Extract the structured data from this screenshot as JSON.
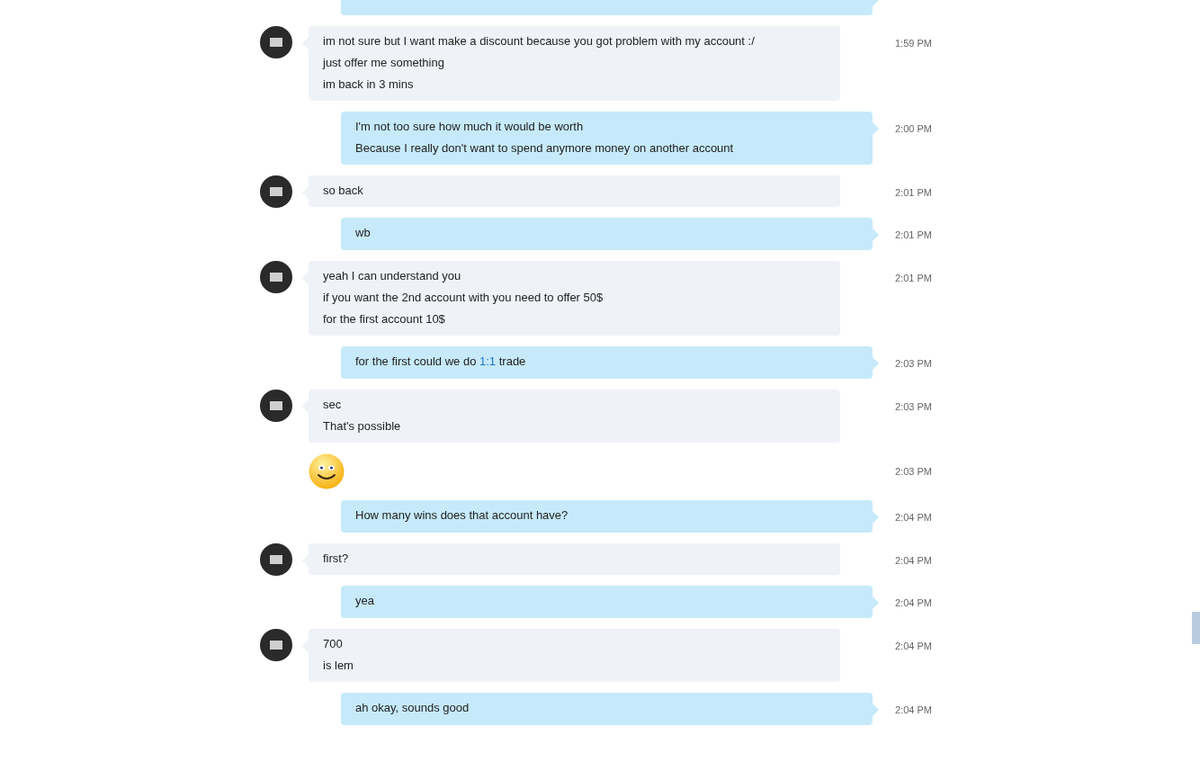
{
  "messages": [
    {
      "kind": "outgoing"
    },
    {
      "kind": "incoming",
      "lines": [
        "im not sure but I want make a discount because you got problem with my account :/",
        "just offer me something",
        "im back in 3 mins"
      ],
      "time": "1:59 PM"
    },
    {
      "kind": "outgoing",
      "lines": [
        "I'm not too sure how much it would be worth",
        "Because I really don't want to spend anymore money on another account"
      ],
      "time": "2:00 PM"
    },
    {
      "kind": "incoming",
      "lines": [
        "so back"
      ],
      "time": "2:01 PM"
    },
    {
      "kind": "outgoing",
      "lines": [
        "wb"
      ],
      "time": "2:01 PM"
    },
    {
      "kind": "incoming",
      "lines": [
        "yeah I can understand you",
        "if you want the 2nd account with you need to offer 50$",
        "for the first account 10$"
      ],
      "time": "2:01 PM"
    },
    {
      "kind": "outgoing",
      "lines": [
        [
          {
            "text": "for the first could we do "
          },
          {
            "text": "1:1",
            "link": true
          },
          {
            "text": " trade"
          }
        ]
      ],
      "time": "2:03 PM"
    },
    {
      "kind": "incoming",
      "lines": [
        "sec",
        "That's possible"
      ],
      "time": "2:03 PM"
    },
    {
      "kind": "emoji",
      "time": "2:03 PM"
    },
    {
      "kind": "outgoing",
      "lines": [
        "How many wins does that account have?"
      ],
      "time": "2:04 PM"
    },
    {
      "kind": "incoming",
      "lines": [
        "first?"
      ],
      "time": "2:04 PM"
    },
    {
      "kind": "outgoing",
      "lines": [
        "yea"
      ],
      "time": "2:04 PM"
    },
    {
      "kind": "incoming",
      "lines": [
        "700",
        "is lem"
      ],
      "time": "2:04 PM"
    },
    {
      "kind": "outgoing",
      "lines": [
        "ah okay, sounds good"
      ],
      "time": "2:04 PM"
    }
  ]
}
